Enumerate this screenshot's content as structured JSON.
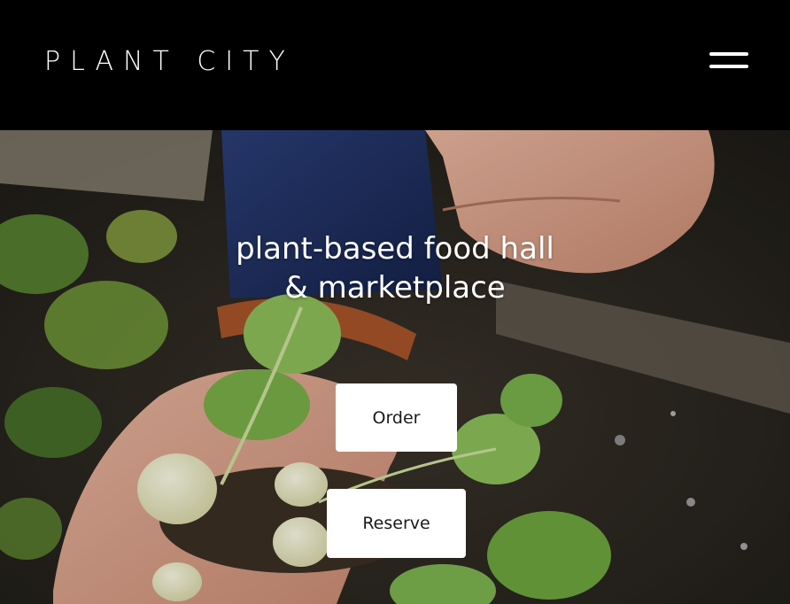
{
  "header": {
    "logo_text": "PLANT CITY",
    "menu_icon": "hamburger-menu-icon"
  },
  "hero": {
    "tagline_line1": "plant-based food hall",
    "tagline_line2": "& marketplace",
    "order_label": "Order",
    "reserve_label": "Reserve"
  },
  "colors": {
    "header_bg": "#000000",
    "button_bg": "#ffffff",
    "button_text": "#1a1a1a",
    "text": "#ffffff"
  }
}
